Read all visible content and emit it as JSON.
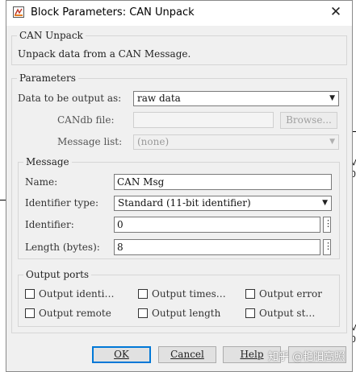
{
  "window": {
    "title": "Block Parameters: CAN Unpack"
  },
  "description_group": {
    "legend": "CAN Unpack",
    "text": "Unpack data from a CAN Message."
  },
  "parameters": {
    "legend": "Parameters",
    "output_as_label": "Data to be output as:",
    "output_as_value": "raw data",
    "candb_label": "CANdb file:",
    "candb_value": "",
    "browse_label": "Browse...",
    "message_list_label": "Message list:",
    "message_list_value": "(none)"
  },
  "message": {
    "legend": "Message",
    "name_label": "Name:",
    "name_value": "CAN Msg",
    "id_type_label": "Identifier type:",
    "id_type_value": "Standard (11-bit identifier)",
    "identifier_label": "Identifier:",
    "identifier_value": "0",
    "length_label": "Length (bytes):",
    "length_value": "8",
    "more_glyph": "⋮"
  },
  "output_ports": {
    "legend": "Output ports",
    "items": [
      {
        "label": "Output identi…",
        "checked": false
      },
      {
        "label": "Output times…",
        "checked": false
      },
      {
        "label": "Output error",
        "checked": false
      },
      {
        "label": "Output remote",
        "checked": false
      },
      {
        "label": "Output length",
        "checked": false
      },
      {
        "label": "Output st…",
        "checked": false
      }
    ]
  },
  "buttons": {
    "ok": "OK",
    "cancel": "Cancel",
    "help": "Help"
  },
  "watermark": "知乎 @艳阳高照",
  "background_labels": {
    "a": "M",
    "b": "0",
    "c": "M",
    "d": "0"
  },
  "colors": {
    "window_bg": "#f0f0f0",
    "focus_border": "#0078d7"
  }
}
